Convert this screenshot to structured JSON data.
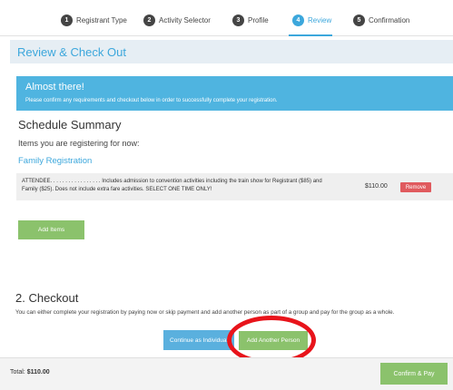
{
  "steps": [
    {
      "num": "1",
      "label": "Registrant Type"
    },
    {
      "num": "2",
      "label": "Activity Selector"
    },
    {
      "num": "3",
      "label": "Profile"
    },
    {
      "num": "4",
      "label": "Review"
    },
    {
      "num": "5",
      "label": "Confirmation"
    }
  ],
  "page_title": "Review & Check Out",
  "alert": {
    "title": "Almost there!",
    "subtitle": "Please confirm any requirements and checkout below in order to successfully complete your registration."
  },
  "schedule": {
    "title": "Schedule Summary",
    "items_label": "Items you are registering for now:",
    "group_name": "Family Registration",
    "item": {
      "description": "ATTENDEE. . . . . . . . . . . . . . . . . Includes admission to convention activities including the train show for Registrant ($85) and Family ($25). Does not include extra fare activities. SELECT ONE TIME ONLY!",
      "price": "$110.00",
      "remove_label": "Remove"
    },
    "add_items_label": "Add Items"
  },
  "checkout": {
    "title": "2. Checkout",
    "text": "You can either complete your registration by paying now or skip payment and add another person as part of a group and pay for the group as a whole.",
    "continue_label": "Continue as Individual",
    "add_person_label": "Add Another Person"
  },
  "footer": {
    "total_label": "Total:",
    "total_value": "$110.00",
    "confirm_label": "Confirm & Pay"
  },
  "colors": {
    "accent": "#3ca7dc",
    "green": "#8bc26c",
    "remove": "#e05a5e",
    "highlight": "#e8141b"
  }
}
